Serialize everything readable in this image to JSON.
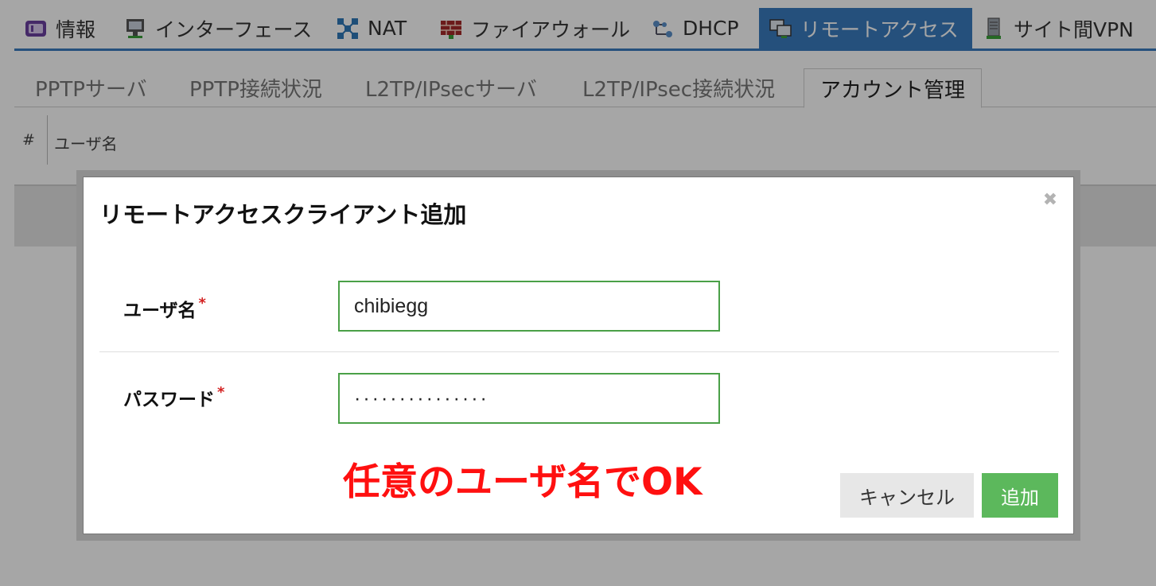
{
  "top_tabs": [
    {
      "label": "情報",
      "icon": "info-icon"
    },
    {
      "label": "インターフェース",
      "icon": "interface-icon"
    },
    {
      "label": "NAT",
      "icon": "nat-icon"
    },
    {
      "label": "ファイアウォール",
      "icon": "firewall-icon"
    },
    {
      "label": "DHCP",
      "icon": "dhcp-icon"
    },
    {
      "label": "リモートアクセス",
      "icon": "remote-access-icon",
      "active": true
    },
    {
      "label": "サイト間VPN",
      "icon": "site-vpn-icon"
    }
  ],
  "sub_tabs": [
    {
      "label": "PPTPサーバ"
    },
    {
      "label": "PPTP接続状況"
    },
    {
      "label": "L2TP/IPsecサーバ"
    },
    {
      "label": "L2TP/IPsec接続状況"
    },
    {
      "label": "アカウント管理",
      "active": true
    }
  ],
  "table": {
    "columns": [
      "#",
      "ユーザ名"
    ]
  },
  "modal": {
    "title": "リモートアクセスクライアント追加",
    "close_icon": "close-icon",
    "fields": {
      "username": {
        "label": "ユーザ名",
        "required_mark": "*",
        "value": "chibiegg"
      },
      "password": {
        "label": "パスワード",
        "required_mark": "*",
        "value": "···············"
      }
    },
    "annotation": "任意のユーザ名でOK",
    "buttons": {
      "cancel": "キャンセル",
      "add": "追加"
    }
  },
  "colors": {
    "accent": "#3a7cbf",
    "input_border": "#4aa047",
    "primary_button": "#5cb85c",
    "annotation": "#ff1010",
    "required": "#d32020"
  }
}
